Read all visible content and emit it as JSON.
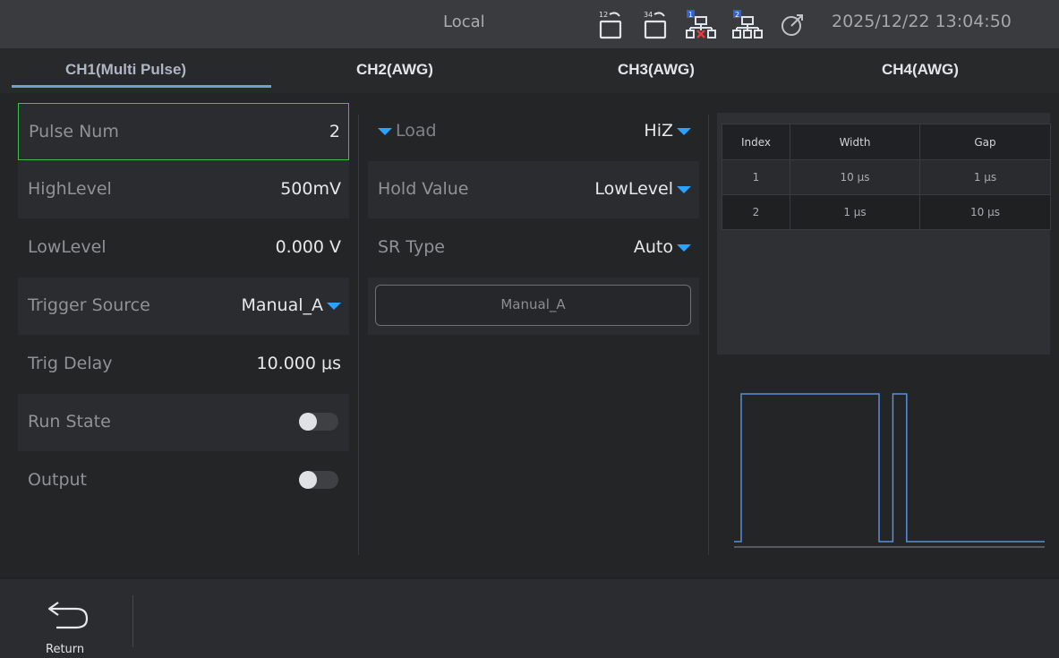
{
  "status_bar": {
    "mode": "Local",
    "datetime": "2025/12/22 13:04:50",
    "icons": [
      "group-12-icon",
      "group-34-icon",
      "network-1-disconnected-icon",
      "network-2-icon",
      "target-icon"
    ],
    "icon_digits": [
      "12",
      "34",
      "1",
      "2"
    ]
  },
  "tabs": [
    {
      "label": "CH1(Multi Pulse)",
      "active": true
    },
    {
      "label": "CH2(AWG)",
      "active": false
    },
    {
      "label": "CH3(AWG)",
      "active": false
    },
    {
      "label": "CH4(AWG)",
      "active": false
    }
  ],
  "left_panel": {
    "pulse_num": {
      "label": "Pulse Num",
      "value": "2"
    },
    "high_level": {
      "label": "HighLevel",
      "value": "500mV"
    },
    "low_level": {
      "label": "LowLevel",
      "value": "0.000 V"
    },
    "trigger_source": {
      "label": "Trigger Source",
      "value": "Manual_A"
    },
    "trig_delay": {
      "label": "Trig Delay",
      "value": "10.000 μs"
    },
    "run_state": {
      "label": "Run State",
      "on": false
    },
    "output": {
      "label": "Output",
      "on": false
    }
  },
  "middle_panel": {
    "load": {
      "label": "Load",
      "value": "HiZ"
    },
    "hold_value": {
      "label": "Hold Value",
      "value": "LowLevel"
    },
    "sr_type": {
      "label": "SR Type",
      "value": "Auto"
    },
    "manual_button": "Manual_A"
  },
  "pulse_table": {
    "headers": [
      "Index",
      "Width",
      "Gap"
    ],
    "rows": [
      [
        "1",
        "10 μs",
        "1 μs"
      ],
      [
        "2",
        "1 μs",
        "10 μs"
      ]
    ]
  },
  "waveform": {
    "pulses": [
      {
        "width_us": 10,
        "gap_us": 1
      },
      {
        "width_us": 1,
        "gap_us": 10
      }
    ]
  },
  "bottom_bar": {
    "return_label": "Return"
  },
  "colors": {
    "accent": "#29a3ff",
    "selection": "#3fbf4c",
    "waveform": "#5b8fd8",
    "tab_underline": "#6f9fd8"
  }
}
